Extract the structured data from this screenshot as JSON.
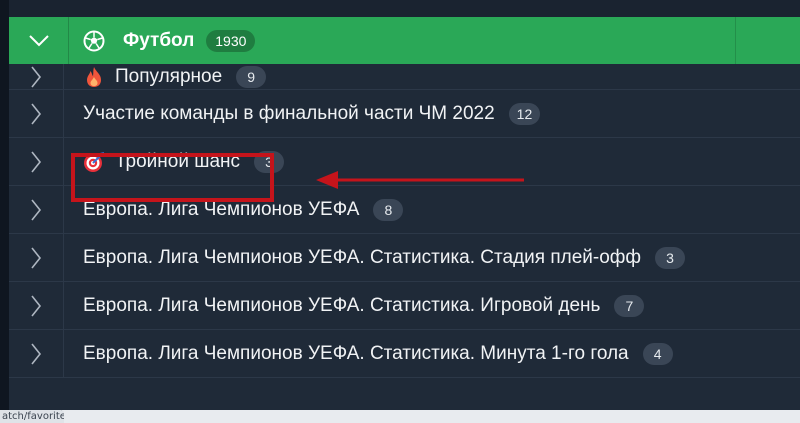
{
  "header": {
    "title": "Футбол",
    "count": "1930",
    "accent": "#2aa857"
  },
  "rows": [
    {
      "label": "Популярное",
      "count": "9",
      "icon": "flame-icon"
    },
    {
      "label": "Участие команды в финальной части ЧМ 2022",
      "count": "12"
    },
    {
      "label": "Тройной шанс",
      "count": "3",
      "icon": "target-icon",
      "highlighted": true
    },
    {
      "label": "Европа. Лига Чемпионов УЕФА",
      "count": "8"
    },
    {
      "label": "Европа. Лига Чемпионов УЕФА. Статистика. Стадия плей-офф",
      "count": "3"
    },
    {
      "label": "Европа. Лига Чемпионов УЕФА. Статистика. Игровой день",
      "count": "7"
    },
    {
      "label": "Европа. Лига Чемпионов УЕФА. Статистика. Минута 1-го гола",
      "count": "4"
    }
  ],
  "status": {
    "url_fragment": "atch/favorites"
  },
  "annotation": {
    "color": "#c5141b"
  }
}
